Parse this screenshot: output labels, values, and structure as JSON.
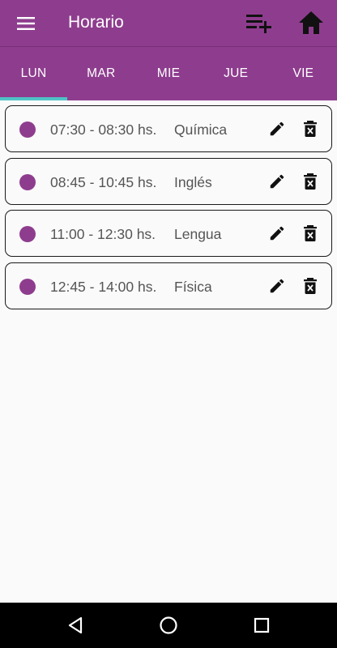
{
  "appbar": {
    "title": "Horario",
    "menu_icon": "hamburger-menu-icon",
    "add_icon": "playlist-add-icon",
    "home_icon": "home-icon"
  },
  "tabs": [
    {
      "label": "LUN",
      "selected": true
    },
    {
      "label": "MAR",
      "selected": false
    },
    {
      "label": "MIE",
      "selected": false
    },
    {
      "label": "JUE",
      "selected": false
    },
    {
      "label": "VIE",
      "selected": false
    }
  ],
  "schedule": [
    {
      "time": "07:30 - 08:30 hs.",
      "subject": "Química"
    },
    {
      "time": "08:45 - 10:45 hs.",
      "subject": "Inglés"
    },
    {
      "time": "11:00 - 12:30 hs.",
      "subject": "Lengua"
    },
    {
      "time": "12:45 - 14:00 hs.",
      "subject": "Física"
    }
  ],
  "navbar": {
    "back_icon": "back-triangle-icon",
    "home_icon": "home-circle-icon",
    "recents_icon": "recents-square-icon"
  },
  "colors": {
    "primary": "#8e3d8e",
    "tab_indicator": "#4fc3c6",
    "background": "#fafafa",
    "navbar": "#000000",
    "text_secondary": "#555555"
  }
}
